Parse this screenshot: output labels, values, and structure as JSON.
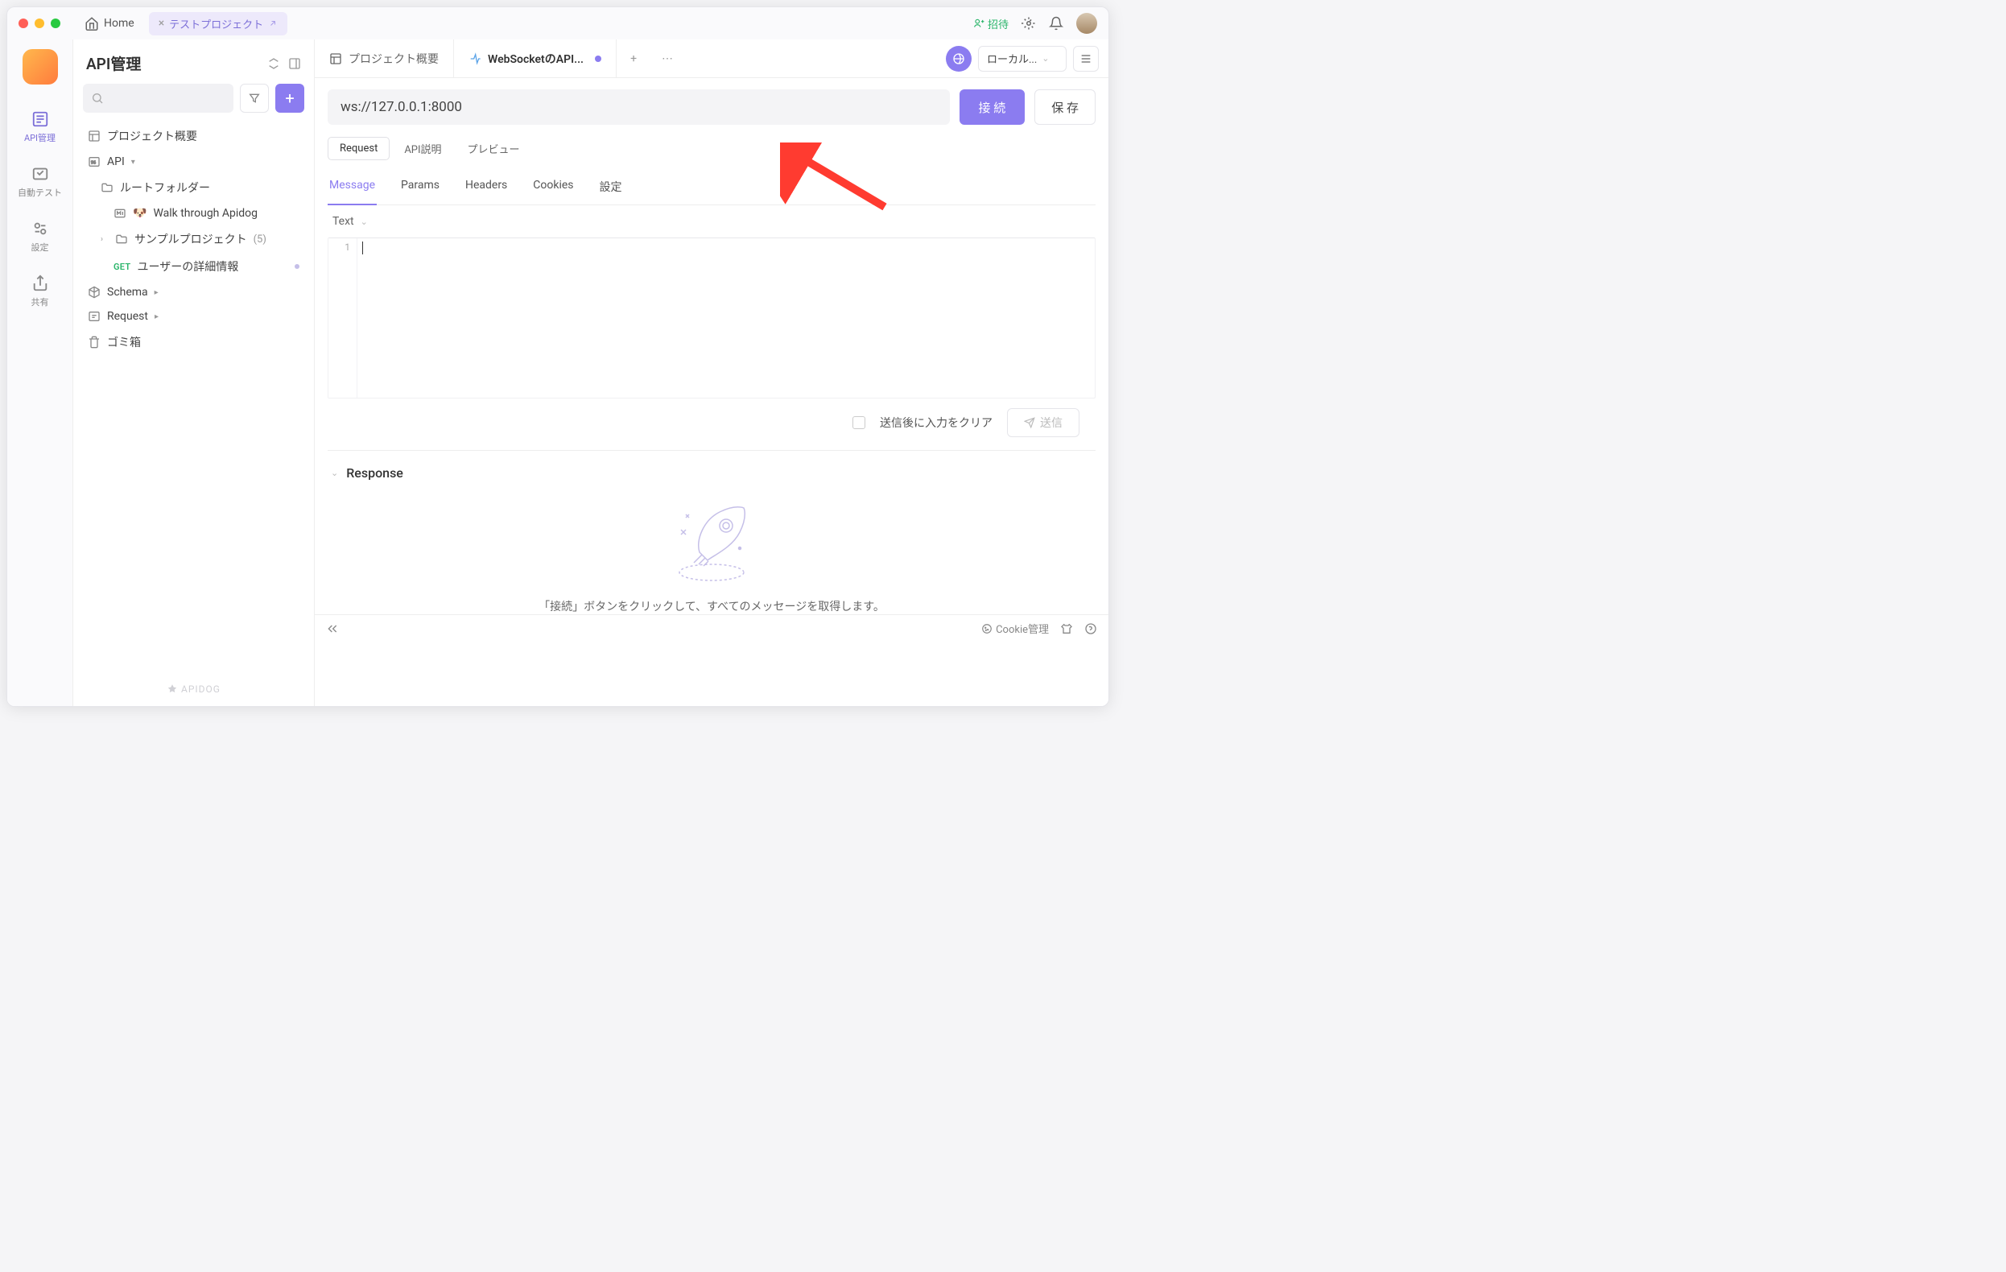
{
  "titlebar": {
    "home_label": "Home",
    "project_tab": "テストプロジェクト",
    "invite_label": "招待"
  },
  "rail": {
    "items": [
      {
        "label": "API管理"
      },
      {
        "label": "自動テスト"
      },
      {
        "label": "設定"
      },
      {
        "label": "共有"
      }
    ]
  },
  "sidebar": {
    "title": "API管理",
    "overview": "プロジェクト概要",
    "api_label": "API",
    "root_folder": "ルートフォルダー",
    "walkthrough": "Walk through Apidog",
    "sample": "サンプルプロジェクト",
    "sample_count": "(5)",
    "get_label": "GET",
    "user_detail": "ユーザーの詳細情報",
    "schema": "Schema",
    "request": "Request",
    "trash": "ゴミ箱",
    "brand": "APIDOG"
  },
  "tabs": {
    "overview": "プロジェクト概要",
    "websocket": "WebSocketのAPI...",
    "env": "ローカル..."
  },
  "url": {
    "value": "ws://127.0.0.1:8000",
    "connect": "接 続",
    "save": "保 存"
  },
  "subtabs": {
    "request": "Request",
    "api_desc": "API説明",
    "preview": "プレビュー"
  },
  "reqtabs": {
    "message": "Message",
    "params": "Params",
    "headers": "Headers",
    "cookies": "Cookies",
    "settings": "設定"
  },
  "editor": {
    "content_type": "Text",
    "line1": "1",
    "clear_after_send": "送信後に入力をクリア",
    "send": "送信"
  },
  "response": {
    "title": "Response",
    "empty_msg": "「接続」ボタンをクリックして、すべてのメッセージを取得します。"
  },
  "footer": {
    "cookie": "Cookie管理"
  }
}
